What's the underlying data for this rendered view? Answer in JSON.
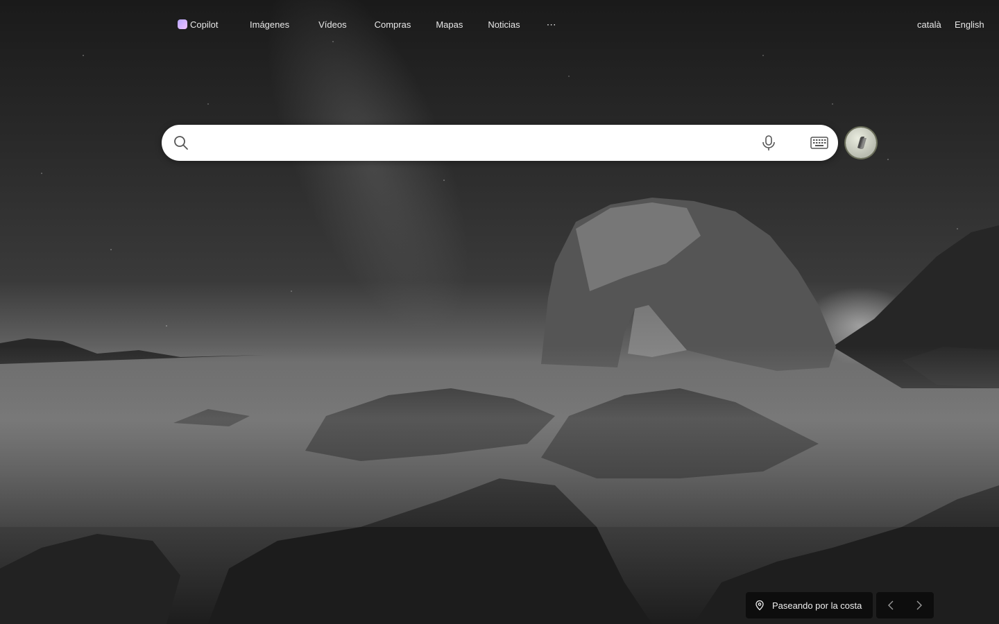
{
  "nav": {
    "items": [
      {
        "label": "Copilot",
        "icon": "copilot-icon"
      },
      {
        "label": "Imágenes"
      },
      {
        "label": "Vídeos"
      },
      {
        "label": "Compras"
      },
      {
        "label": "Mapas"
      },
      {
        "label": "Noticias"
      },
      {
        "label": "⋯"
      }
    ]
  },
  "languages": [
    {
      "label": "català"
    },
    {
      "label": "English"
    }
  ],
  "search": {
    "value": "",
    "placeholder": "",
    "search_icon": "search-icon",
    "mic_icon": "microphone-icon",
    "keyboard_icon": "keyboard-icon",
    "copilot_icon": "copilot-icon"
  },
  "background": {
    "caption": "Paseando por la costa",
    "caption_icon": "location-pin-icon",
    "prev_icon": "chevron-left-icon",
    "next_icon": "chevron-right-icon"
  }
}
